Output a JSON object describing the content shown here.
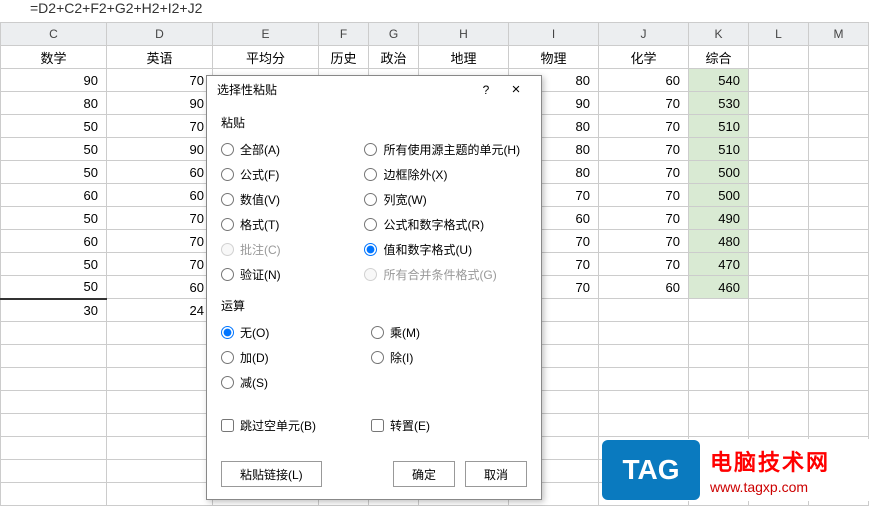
{
  "formula": "=D2+C2+F2+G2+H2+I2+J2",
  "cols": [
    "C",
    "D",
    "E",
    "F",
    "G",
    "H",
    "I",
    "J",
    "K",
    "L",
    "M"
  ],
  "headers": {
    "C": "数学",
    "D": "英语",
    "E": "平均分",
    "F": "历史",
    "G": "政治",
    "H": "地理",
    "I": "物理",
    "J": "化学",
    "K": "综合"
  },
  "rows": [
    {
      "C": "90",
      "D": "70",
      "E": "",
      "F": "",
      "G": "",
      "H": "",
      "I": "80",
      "J": "60",
      "K": "540"
    },
    {
      "C": "80",
      "D": "90",
      "E": "",
      "F": "",
      "G": "",
      "H": "",
      "I": "90",
      "J": "70",
      "K": "530"
    },
    {
      "C": "50",
      "D": "70",
      "E": "",
      "F": "",
      "G": "",
      "H": "",
      "I": "80",
      "J": "70",
      "K": "510"
    },
    {
      "C": "50",
      "D": "90",
      "E": "",
      "F": "",
      "G": "",
      "H": "",
      "I": "80",
      "J": "70",
      "K": "510"
    },
    {
      "C": "50",
      "D": "60",
      "E": "",
      "F": "",
      "G": "",
      "H": "",
      "I": "80",
      "J": "70",
      "K": "500"
    },
    {
      "C": "60",
      "D": "60",
      "E": "",
      "F": "",
      "G": "",
      "H": "",
      "I": "70",
      "J": "70",
      "K": "500"
    },
    {
      "C": "50",
      "D": "70",
      "E": "",
      "F": "",
      "G": "",
      "H": "",
      "I": "60",
      "J": "70",
      "K": "490"
    },
    {
      "C": "60",
      "D": "70",
      "E": "",
      "F": "",
      "G": "",
      "H": "",
      "I": "70",
      "J": "70",
      "K": "480"
    },
    {
      "C": "50",
      "D": "70",
      "E": "",
      "F": "",
      "G": "",
      "H": "",
      "I": "70",
      "J": "70",
      "K": "470"
    },
    {
      "C": "50",
      "D": "60",
      "E": "",
      "F": "",
      "G": "",
      "H": "",
      "I": "70",
      "J": "60",
      "K": "460"
    },
    {
      "C": "30",
      "D": "24",
      "E": "",
      "F": "",
      "G": "",
      "H": "",
      "I": "",
      "J": "",
      "K": ""
    }
  ],
  "dialog": {
    "title": "选择性粘贴",
    "help": "?",
    "close": "×",
    "paste_label": "粘贴",
    "paste_left": [
      {
        "key": "all",
        "label": "全部(A)"
      },
      {
        "key": "formula",
        "label": "公式(F)"
      },
      {
        "key": "value",
        "label": "数值(V)"
      },
      {
        "key": "format",
        "label": "格式(T)"
      },
      {
        "key": "comment",
        "label": "批注(C)",
        "disabled": true
      },
      {
        "key": "validate",
        "label": "验证(N)"
      }
    ],
    "paste_right": [
      {
        "key": "theme",
        "label": "所有使用源主题的单元(H)"
      },
      {
        "key": "noborder",
        "label": "边框除外(X)"
      },
      {
        "key": "colwidth",
        "label": "列宽(W)"
      },
      {
        "key": "fmtnum",
        "label": "公式和数字格式(R)"
      },
      {
        "key": "valnum",
        "label": "值和数字格式(U)",
        "checked": true
      },
      {
        "key": "mergecond",
        "label": "所有合并条件格式(G)",
        "disabled": true
      }
    ],
    "op_label": "运算",
    "op_left": [
      {
        "key": "none",
        "label": "无(O)",
        "checked": true
      },
      {
        "key": "add",
        "label": "加(D)"
      },
      {
        "key": "sub",
        "label": "减(S)"
      }
    ],
    "op_right": [
      {
        "key": "mul",
        "label": "乘(M)"
      },
      {
        "key": "div",
        "label": "除(I)"
      }
    ],
    "skip_blank": "跳过空单元(B)",
    "transpose": "转置(E)",
    "paste_link": "粘贴链接(L)",
    "ok": "确定",
    "cancel": "取消"
  },
  "tag": {
    "badge": "TAG",
    "l1": "电脑技术网",
    "l2": "www.tagxp.com"
  }
}
